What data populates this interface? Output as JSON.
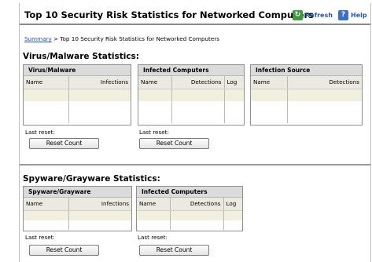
{
  "header": {
    "title": "Top 10 Security Risk Statistics for Networked Computers",
    "refresh_label": "Refresh",
    "help_label": "Help",
    "refresh_icon": "refresh-icon",
    "help_icon": "help-icon"
  },
  "breadcrumb": {
    "root": "Summary",
    "separator": ">",
    "current": "Top 10 Security Risk Statistics for Networked Computers"
  },
  "virus_section": {
    "heading": "Virus/Malware Statistics:",
    "panels": [
      {
        "title": "Virus/Malware",
        "columns": [
          "Name",
          "Infections"
        ]
      },
      {
        "title": "Infected Computers",
        "columns": [
          "Name",
          "Detections",
          "Log"
        ]
      },
      {
        "title": "Infection Source",
        "columns": [
          "Name",
          "Detections"
        ]
      }
    ],
    "resets": [
      {
        "label": "Last reset:",
        "button": "Reset Count"
      },
      {
        "label": "Last reset:",
        "button": "Reset Count"
      }
    ]
  },
  "spyware_section": {
    "heading": "Spyware/Grayware Statistics:",
    "panels": [
      {
        "title": "Spyware/Grayware",
        "columns": [
          "Name",
          "Infections"
        ]
      },
      {
        "title": "Infected Computers",
        "columns": [
          "Name",
          "Detections",
          "Log"
        ]
      }
    ],
    "resets": [
      {
        "label": "Last reset:",
        "button": "Reset Count"
      },
      {
        "label": "Last reset:",
        "button": "Reset Count"
      }
    ]
  },
  "colors": {
    "panel_header": "#dbdbdb",
    "column_header": "#ebeae1",
    "row_shade": "#f1efde",
    "link": "#2b54a6"
  }
}
